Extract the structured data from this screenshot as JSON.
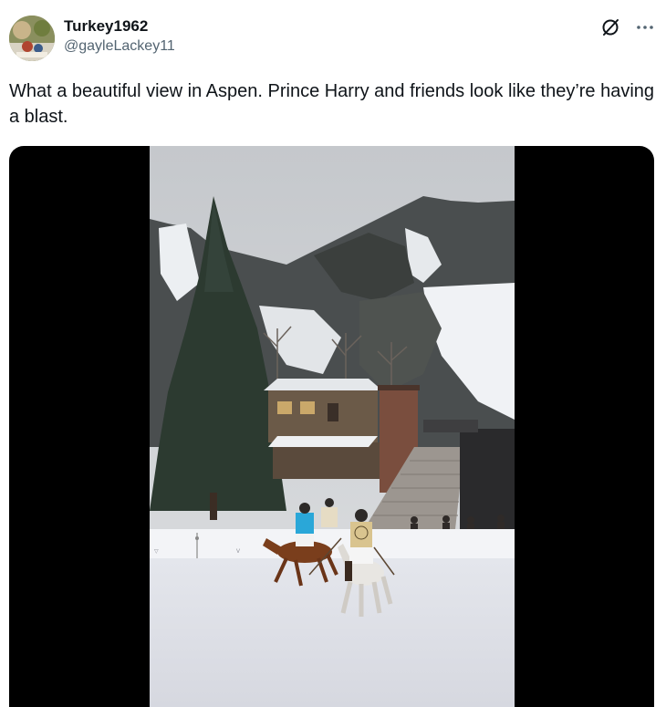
{
  "user": {
    "display_name": "Turkey1962",
    "handle": "@gayleLackey11"
  },
  "tweet": {
    "text": "What a beautiful view in Aspen. Prince Harry and friends look like they’re having a blast."
  },
  "icons": {
    "grok": "grok-slash-circle-icon",
    "more": "more-horizontal-icon"
  },
  "media": {
    "type": "video",
    "scene": "video-frame-polo-on-snow"
  },
  "colors": {
    "text_primary": "#0f1419",
    "text_secondary": "#536471",
    "media_letterbox": "#000000"
  }
}
